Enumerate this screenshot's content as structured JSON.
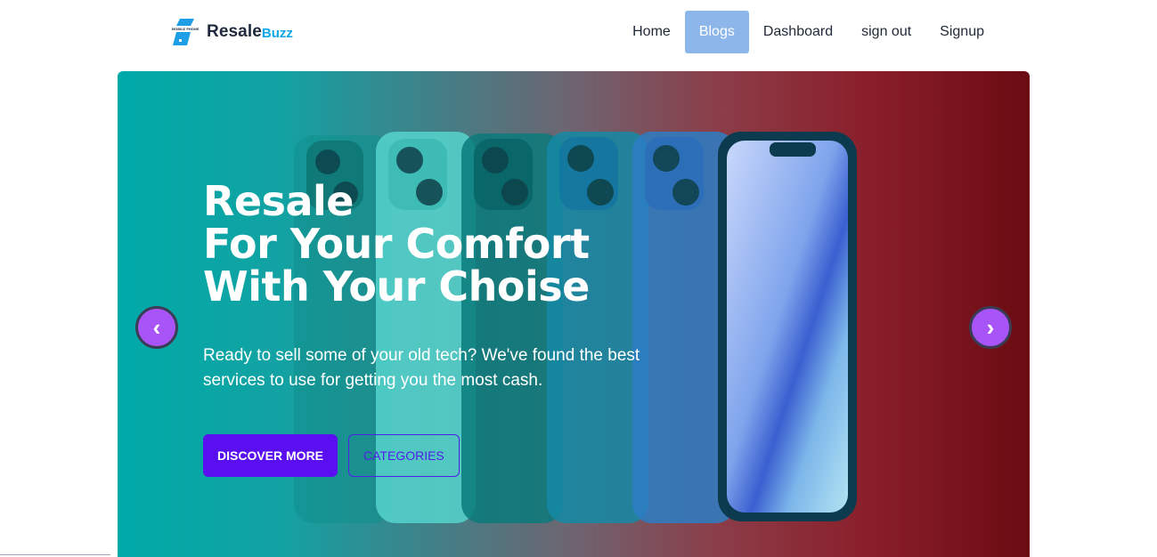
{
  "brand": {
    "name": "Resale",
    "accent": "Buzz",
    "logo_icon": "phone-store-logo"
  },
  "nav": {
    "items": [
      {
        "label": "Home",
        "active": false
      },
      {
        "label": "Blogs",
        "active": true
      },
      {
        "label": "Dashboard",
        "active": false
      },
      {
        "label": "sign out",
        "active": false
      },
      {
        "label": "Signup",
        "active": false
      }
    ]
  },
  "hero": {
    "title": "Resale\nFor Your Comfort\nWith Your Choise",
    "subtitle": "Ready to sell some of your old tech? We've found the best services to use for getting you the most cash.",
    "primary_button": "DISCOVER MORE",
    "secondary_button": "CATEGORIES",
    "prev_arrow": "‹",
    "next_arrow": "›"
  },
  "colors": {
    "primary": "#5a0ff0",
    "arrow": "#a855f7",
    "active_nav": "#8db7ea",
    "brand_accent": "#0ea5e9"
  }
}
